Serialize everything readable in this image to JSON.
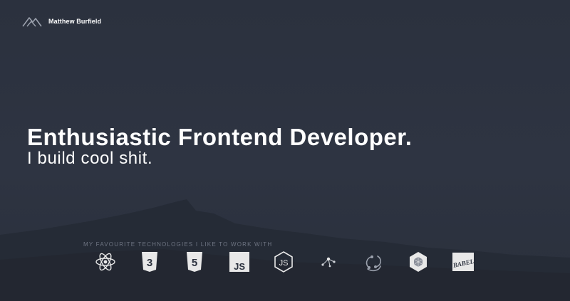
{
  "site": {
    "owner_name": "Matthew Burfield"
  },
  "hero": {
    "headline": "Enthusiastic Frontend Developer.",
    "subheadline": "I build cool shit."
  },
  "technologies": {
    "label": "MY FAVOURITE TECHNOLOGIES I LIKE TO WORK WITH",
    "items": [
      {
        "name": "react-icon",
        "glyph": ""
      },
      {
        "name": "css3-icon",
        "glyph": "3"
      },
      {
        "name": "html5-icon",
        "glyph": "5"
      },
      {
        "name": "javascript-icon",
        "glyph": "JS"
      },
      {
        "name": "nodejs-icon",
        "glyph": "JS"
      },
      {
        "name": "graphql-like-icon",
        "glyph": ""
      },
      {
        "name": "redux-icon",
        "glyph": ""
      },
      {
        "name": "webpack-icon",
        "glyph": ""
      },
      {
        "name": "babel-icon",
        "glyph": "BABEL"
      }
    ]
  },
  "colors": {
    "background": "#2b313e",
    "text": "#ffffff",
    "muted": "#6e7482",
    "icon_light": "#e8e8e8",
    "icon_dark": "#2b313e"
  }
}
